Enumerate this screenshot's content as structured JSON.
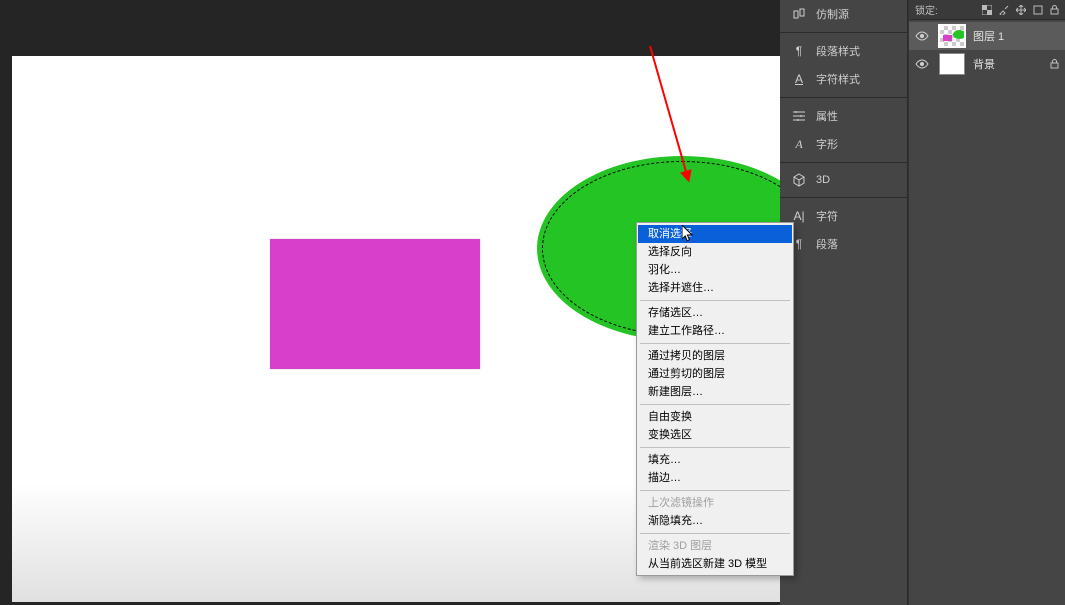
{
  "panel_entries": {
    "clone_source": "仿制源",
    "paragraph_styles": "段落样式",
    "character_styles": "字符样式",
    "properties": "属性",
    "glyphs": "字形",
    "three_d": "3D",
    "character": "字符",
    "paragraph": "段落"
  },
  "layers": {
    "lock_label": "锁定:",
    "rows": [
      {
        "name": "图层 1",
        "active": true
      },
      {
        "name": "背景",
        "active": false
      }
    ]
  },
  "context_menu": {
    "items": [
      {
        "label": "取消选择",
        "selected": true
      },
      {
        "label": "选择反向"
      },
      {
        "label": "羽化…"
      },
      {
        "label": "选择并遮住…"
      },
      {
        "sep": true
      },
      {
        "label": "存储选区…"
      },
      {
        "label": "建立工作路径…"
      },
      {
        "sep": true
      },
      {
        "label": "通过拷贝的图层"
      },
      {
        "label": "通过剪切的图层"
      },
      {
        "label": "新建图层…"
      },
      {
        "sep": true
      },
      {
        "label": "自由变换"
      },
      {
        "label": "变换选区"
      },
      {
        "sep": true
      },
      {
        "label": "填充…"
      },
      {
        "label": "描边…"
      },
      {
        "sep": true
      },
      {
        "label": "上次滤镜操作",
        "disabled": true
      },
      {
        "label": "渐隐填充…"
      },
      {
        "sep": true
      },
      {
        "label": "渲染 3D 图层",
        "disabled": true
      },
      {
        "label": "从当前选区新建 3D 模型"
      }
    ]
  },
  "colors": {
    "rect_fill": "#d83fcb",
    "ellipse_fill": "#23c423",
    "arrow": "#ff0000",
    "menu_highlight": "#0a60d8"
  }
}
